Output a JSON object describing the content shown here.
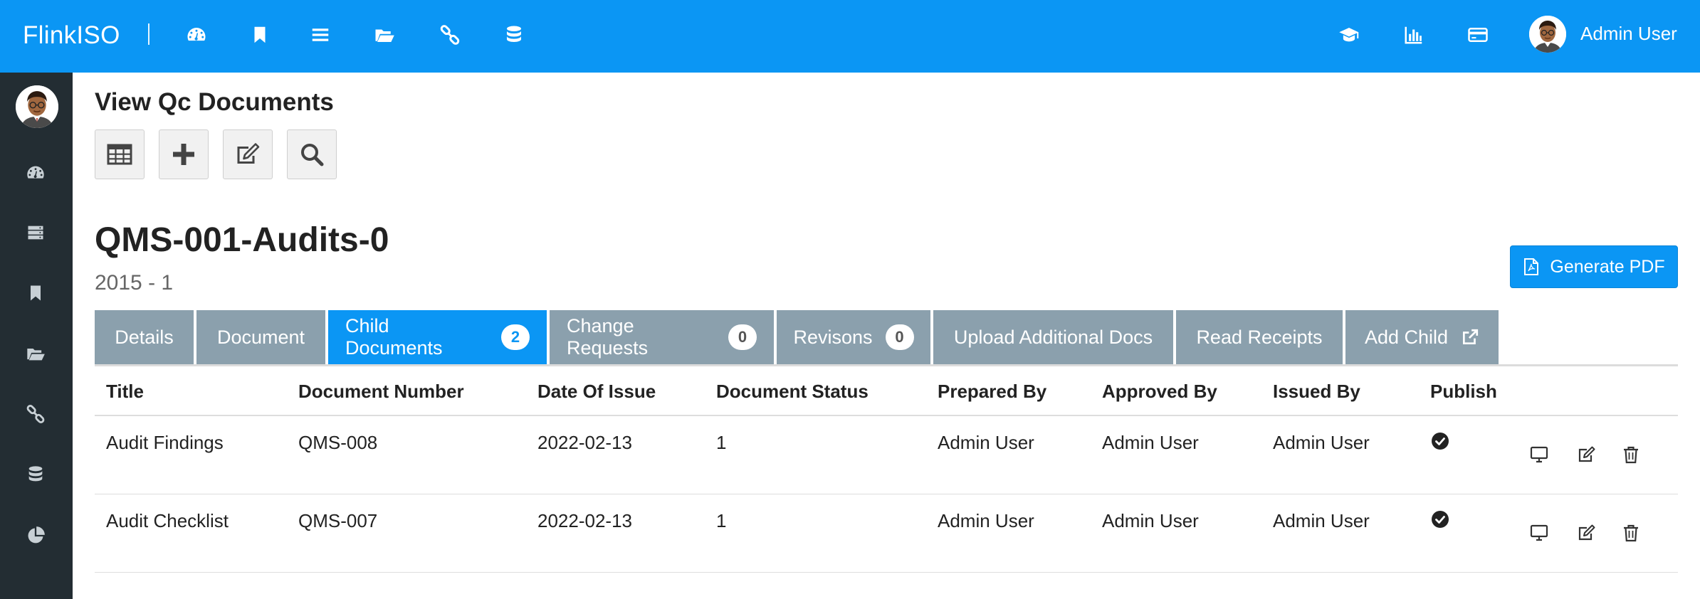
{
  "app": {
    "brand": "FlinkISO",
    "user_name": "Admin User"
  },
  "topnav": {
    "left_icons": [
      "dashboard-icon",
      "bookmark-icon",
      "list-icon",
      "folder-open-icon",
      "link-icon",
      "database-icon"
    ],
    "right_icons": [
      "graduation-cap-icon",
      "bar-chart-icon",
      "credit-card-icon"
    ]
  },
  "sidebar": {
    "icons": [
      "dashboard-icon",
      "server-icon",
      "bookmark-icon",
      "folder-open-icon",
      "link-icon",
      "database-icon",
      "pie-chart-icon"
    ]
  },
  "page": {
    "title": "View Qc Documents"
  },
  "toolbar": {
    "icons": [
      "table-icon",
      "plus-icon",
      "edit-icon",
      "search-icon"
    ]
  },
  "document": {
    "title": "QMS-001-Audits-0",
    "subtitle": "2015 - 1"
  },
  "generate_pdf": {
    "label": "Generate PDF"
  },
  "tabs": [
    {
      "label": "Details"
    },
    {
      "label": "Document"
    },
    {
      "label": "Child Documents",
      "badge": "2",
      "active": true
    },
    {
      "label": "Change Requests",
      "badge": "0"
    },
    {
      "label": "Revisons",
      "badge": "0"
    },
    {
      "label": "Upload Additional Docs"
    },
    {
      "label": "Read Receipts"
    },
    {
      "label": "Add Child"
    }
  ],
  "table": {
    "headers": [
      "Title",
      "Document Number",
      "Date Of Issue",
      "Document Status",
      "Prepared By",
      "Approved By",
      "Issued By",
      "Publish"
    ],
    "rows": [
      {
        "title": "Audit Findings",
        "number": "QMS-008",
        "date": "2022-02-13",
        "status": "1",
        "prepared": "Admin User",
        "approved": "Admin User",
        "issued": "Admin User"
      },
      {
        "title": "Audit Checklist",
        "number": "QMS-007",
        "date": "2022-02-13",
        "status": "1",
        "prepared": "Admin User",
        "approved": "Admin User",
        "issued": "Admin User"
      }
    ]
  },
  "colors": {
    "primary": "#0b96f4",
    "tab_inactive": "#8ba0ad",
    "sidebar": "#232d33"
  }
}
